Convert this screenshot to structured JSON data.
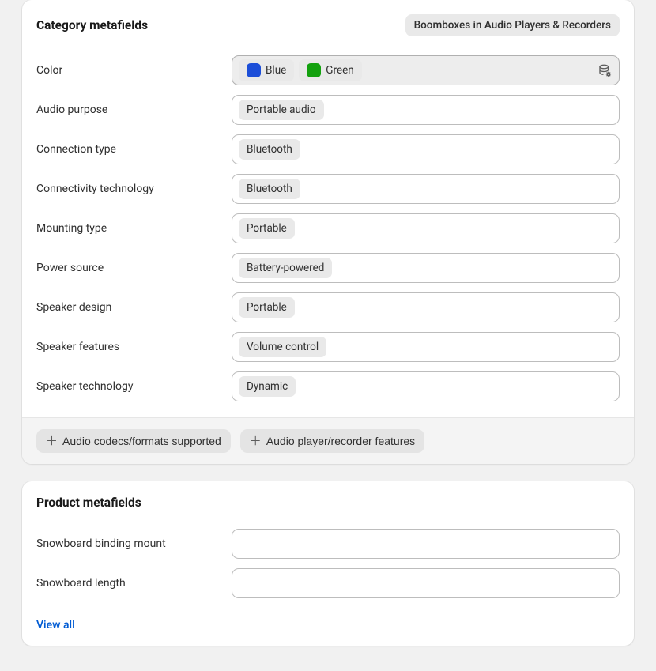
{
  "category_card": {
    "title": "Category metafields",
    "badge": "Boomboxes in Audio Players & Recorders",
    "rows": [
      {
        "label": "Color",
        "highlight": true,
        "tags": [
          {
            "text": "Blue",
            "swatch": "blue"
          },
          {
            "text": "Green",
            "swatch": "green"
          }
        ],
        "action_icon": "data-manager-icon"
      },
      {
        "label": "Audio purpose",
        "tags": [
          {
            "text": "Portable audio"
          }
        ]
      },
      {
        "label": "Connection type",
        "tags": [
          {
            "text": "Bluetooth"
          }
        ]
      },
      {
        "label": "Connectivity technology",
        "tags": [
          {
            "text": "Bluetooth"
          }
        ]
      },
      {
        "label": "Mounting type",
        "tags": [
          {
            "text": "Portable"
          }
        ]
      },
      {
        "label": "Power source",
        "tags": [
          {
            "text": "Battery-powered"
          }
        ]
      },
      {
        "label": "Speaker design",
        "tags": [
          {
            "text": "Portable"
          }
        ]
      },
      {
        "label": "Speaker features",
        "tags": [
          {
            "text": "Volume control"
          }
        ]
      },
      {
        "label": "Speaker technology",
        "tags": [
          {
            "text": "Dynamic"
          }
        ]
      }
    ],
    "footer_chips": [
      "Audio codecs/formats supported",
      "Audio player/recorder features"
    ]
  },
  "product_card": {
    "title": "Product metafields",
    "rows": [
      {
        "label": "Snowboard binding mount"
      },
      {
        "label": "Snowboard length"
      }
    ],
    "view_all": "View all"
  }
}
